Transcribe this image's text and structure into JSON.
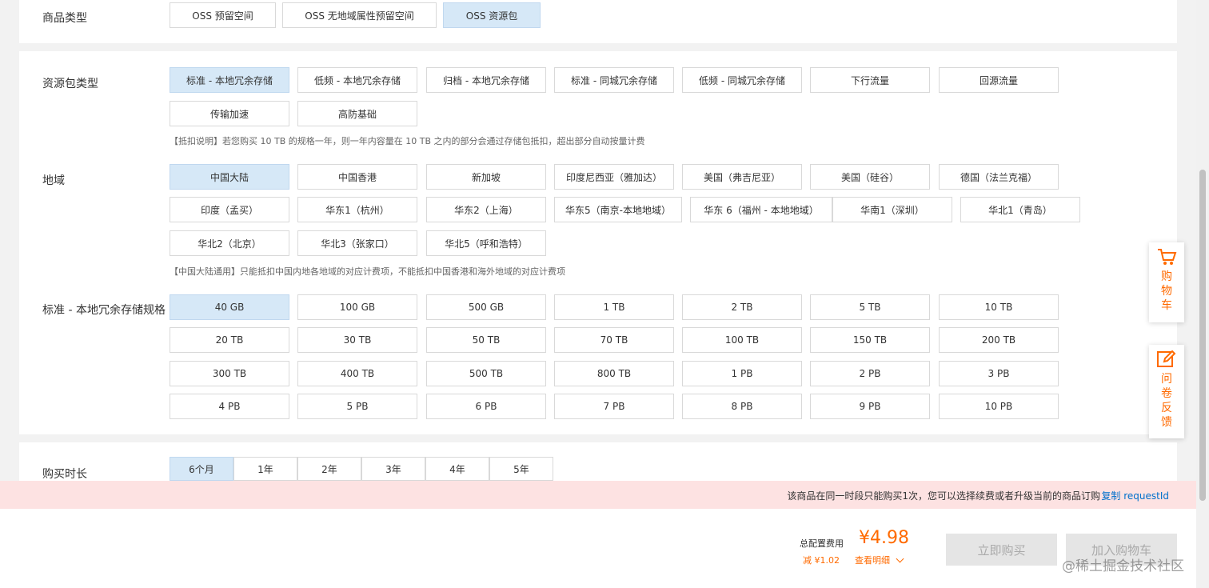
{
  "product_type": {
    "label": "商品类型",
    "options": [
      "OSS 预留空间",
      "OSS 无地域属性预留空间",
      "OSS 资源包"
    ],
    "selected": 2
  },
  "package_type": {
    "label": "资源包类型",
    "options": [
      "标准 - 本地冗余存储",
      "低频 - 本地冗余存储",
      "归档 - 本地冗余存储",
      "标准 - 同城冗余存储",
      "低频 - 同城冗余存储",
      "下行流量",
      "回源流量",
      "传输加速",
      "高防基础"
    ],
    "selected": 0,
    "note": "【抵扣说明】若您购买 10 TB 的规格一年，则一年内容量在 10 TB 之内的部分会通过存储包抵扣，超出部分自动按量计费"
  },
  "region": {
    "label": "地域",
    "options": [
      "中国大陆",
      "中国香港",
      "新加坡",
      "印度尼西亚（雅加达）",
      "美国（弗吉尼亚）",
      "美国（硅谷）",
      "德国（法兰克福）",
      "印度（孟买）",
      "华东1（杭州）",
      "华东2（上海）",
      "华东5（南京-本地地域）",
      "华东 6（福州 - 本地地域）",
      "华南1（深圳）",
      "华北1（青岛）",
      "华北2（北京）",
      "华北3（张家口）",
      "华北5（呼和浩特）"
    ],
    "selected": 0,
    "note": "【中国大陆通用】只能抵扣中国内地各地域的对应计费项，不能抵扣中国香港和海外地域的对应计费项"
  },
  "spec": {
    "label": "标准 - 本地冗余存储规格",
    "options": [
      "40 GB",
      "100 GB",
      "500 GB",
      "1 TB",
      "2 TB",
      "5 TB",
      "10 TB",
      "20 TB",
      "30 TB",
      "50 TB",
      "70 TB",
      "100 TB",
      "150 TB",
      "200 TB",
      "300 TB",
      "400 TB",
      "500 TB",
      "800 TB",
      "1 PB",
      "2 PB",
      "3 PB",
      "4 PB",
      "5 PB",
      "6 PB",
      "7 PB",
      "8 PB",
      "9 PB",
      "10 PB"
    ],
    "selected": 0
  },
  "duration": {
    "label": "购买时长",
    "options": [
      "6个月",
      "1年",
      "2年",
      "3年",
      "4年",
      "5年"
    ],
    "selected": 0
  },
  "alert": {
    "text": "该商品在同一时段只能购买1次，您可以选择续费或者升级当前的商品订购",
    "link": "复制 requestId"
  },
  "footer": {
    "total_label": "总配置费用",
    "price": "¥4.98",
    "discount": "减 ¥1.02",
    "details": "查看明细",
    "buy_now": "立即购买",
    "add_cart": "加入购物车",
    "watermark": "@稀土掘金技术社区"
  },
  "side": {
    "cart": "购物车",
    "feedback": "问卷反馈"
  },
  "colors": {
    "accent": "#ff6a00",
    "selected_bg": "#d6e8f7",
    "link": "#0070cc",
    "alert_bg": "#fde2e2"
  }
}
